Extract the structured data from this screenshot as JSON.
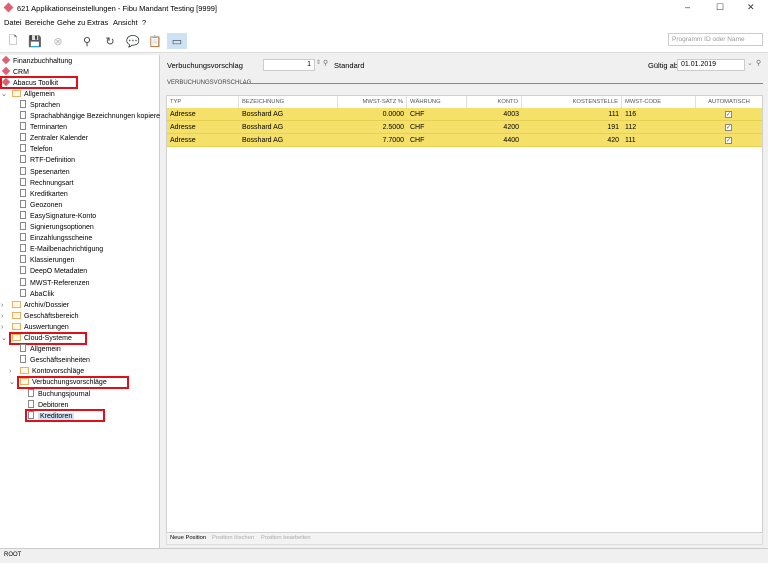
{
  "window": {
    "title": "621 Applikationseinstellungen - Fibu Mandant Testing [9999]",
    "minimize": "–",
    "maximize": "☐",
    "close": "✕"
  },
  "menu": [
    "Datei",
    "Bereiche",
    "Gehe zu",
    "Extras",
    "Ansicht",
    "?"
  ],
  "toolbar": {
    "icons": [
      "new-document-icon",
      "save-icon",
      "cancel-icon",
      "search-icon",
      "refresh-icon",
      "comment-add-icon",
      "clipboard-add-icon",
      "window-icon"
    ],
    "search_placeholder": "Programm ID oder Name"
  },
  "tree": [
    {
      "label": "Finanzbuchhaltung",
      "type": "module",
      "level": 0
    },
    {
      "label": "CRM",
      "type": "module",
      "level": 0
    },
    {
      "label": "Abacus Toolkit",
      "type": "module",
      "level": 0,
      "highlighted": true
    },
    {
      "label": "Allgemein",
      "type": "folder",
      "level": 1,
      "expanded": true
    },
    {
      "label": "Sprachen",
      "type": "doc",
      "level": 2
    },
    {
      "label": "Sprachabhängige Bezeichnungen kopieren",
      "type": "doc",
      "level": 2
    },
    {
      "label": "Terminarten",
      "type": "doc",
      "level": 2
    },
    {
      "label": "Zentraler Kalender",
      "type": "doc",
      "level": 2
    },
    {
      "label": "Telefon",
      "type": "doc",
      "level": 2
    },
    {
      "label": "RTF-Definition",
      "type": "doc",
      "level": 2
    },
    {
      "label": "Spesenarten",
      "type": "doc",
      "level": 2
    },
    {
      "label": "Rechnungsart",
      "type": "doc",
      "level": 2
    },
    {
      "label": "Kreditkarten",
      "type": "doc",
      "level": 2
    },
    {
      "label": "Geozonen",
      "type": "doc",
      "level": 2
    },
    {
      "label": "EasySignature-Konto",
      "type": "doc",
      "level": 2
    },
    {
      "label": "Signierungsoptionen",
      "type": "doc",
      "level": 2
    },
    {
      "label": "Einzahlungsscheine",
      "type": "doc",
      "level": 2
    },
    {
      "label": "E-Mailbenachrichtigung",
      "type": "doc",
      "level": 2
    },
    {
      "label": "Klassierungen",
      "type": "doc",
      "level": 2
    },
    {
      "label": "DeepO Metadaten",
      "type": "doc",
      "level": 2
    },
    {
      "label": "MWST-Referenzen",
      "type": "doc",
      "level": 2
    },
    {
      "label": "AbaClik",
      "type": "doc",
      "level": 2
    },
    {
      "label": "Archiv/Dossier",
      "type": "folder",
      "level": 1,
      "expanded": false
    },
    {
      "label": "Geschäftsbereich",
      "type": "folder",
      "level": 1,
      "expanded": false
    },
    {
      "label": "Auswertungen",
      "type": "folder",
      "level": 1,
      "expanded": false
    },
    {
      "label": "Cloud-Systeme",
      "type": "folder",
      "level": 1,
      "expanded": true,
      "highlighted": true
    },
    {
      "label": "Allgemein",
      "type": "doc",
      "level": 2
    },
    {
      "label": "Geschäftseinheiten",
      "type": "doc",
      "level": 2
    },
    {
      "label": "Kontovorschläge",
      "type": "folder",
      "level": 2,
      "expanded": false
    },
    {
      "label": "Verbuchungsvorschläge",
      "type": "folder",
      "level": 2,
      "expanded": true,
      "highlighted": true
    },
    {
      "label": "Buchungsjournal",
      "type": "doc",
      "level": 3
    },
    {
      "label": "Debitoren",
      "type": "doc",
      "level": 3
    },
    {
      "label": "Kreditoren",
      "type": "doc",
      "level": 3,
      "selected": true,
      "highlighted": true
    }
  ],
  "form": {
    "label": "Verbuchungsvorschlag",
    "value": "1",
    "name": "Standard",
    "valid_label": "Gültig ab",
    "valid_value": "01.01.2019"
  },
  "section": "VERBUCHUNGSVORSCHLAG",
  "table": {
    "columns": [
      "TYP",
      "BEZEICHNUNG",
      "MWST-SATZ %",
      "WÄHRUNG",
      "KONTO",
      "KOSTENSTELLE",
      "MWST-CODE",
      "AUTOMATISCH"
    ],
    "rows": [
      [
        "Adresse",
        "Bosshard AG",
        "0.0000",
        "CHF",
        "4003",
        "111",
        "116",
        true
      ],
      [
        "Adresse",
        "Bosshard AG",
        "2.5000",
        "CHF",
        "4200",
        "191",
        "112",
        true
      ],
      [
        "Adresse",
        "Bosshard AG",
        "7.7000",
        "CHF",
        "4400",
        "420",
        "111",
        true
      ]
    ]
  },
  "actions": [
    {
      "label": "Neue Position",
      "enabled": true
    },
    {
      "label": "Position löschen",
      "enabled": false
    },
    {
      "label": "Position bearbeiten",
      "enabled": false
    }
  ],
  "status": "ROOT",
  "colors": {
    "highlight_border": "#e0101a",
    "row_highlight": "#f5e06a",
    "accent_line": "#6a8fb5"
  }
}
